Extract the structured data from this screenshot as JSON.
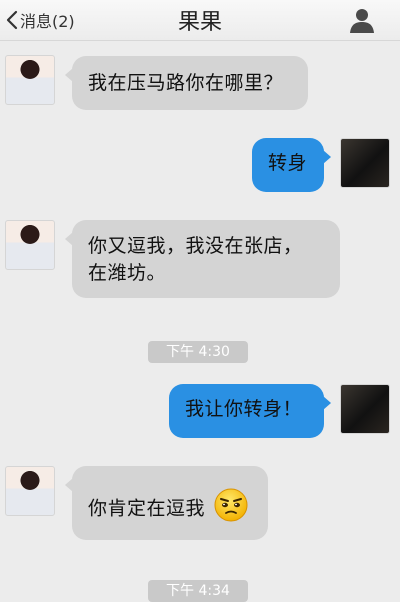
{
  "header": {
    "back_label": "消息(2)",
    "title": "果果"
  },
  "messages": [
    {
      "direction": "incoming",
      "text": "我在压马路你在哪里？"
    },
    {
      "direction": "outgoing",
      "text": "转身"
    },
    {
      "direction": "incoming",
      "text_line1": "你又逗我，我没在张店，",
      "text_line2": "在潍坊。"
    },
    {
      "direction": "outgoing",
      "text": "我让你转身！"
    },
    {
      "direction": "incoming",
      "text": "你肯定在逗我",
      "emoji": "squinting-skeptical-face"
    }
  ],
  "timestamps": [
    "下午 4:30",
    "下午 4:34"
  ],
  "colors": {
    "outgoing_bubble": "#2a90e3",
    "incoming_bubble": "#d4d4d4",
    "background": "#ececec"
  },
  "icons": {
    "back": "chevron-left-icon",
    "profile": "person-icon",
    "emoji": "squinting-face-icon"
  }
}
